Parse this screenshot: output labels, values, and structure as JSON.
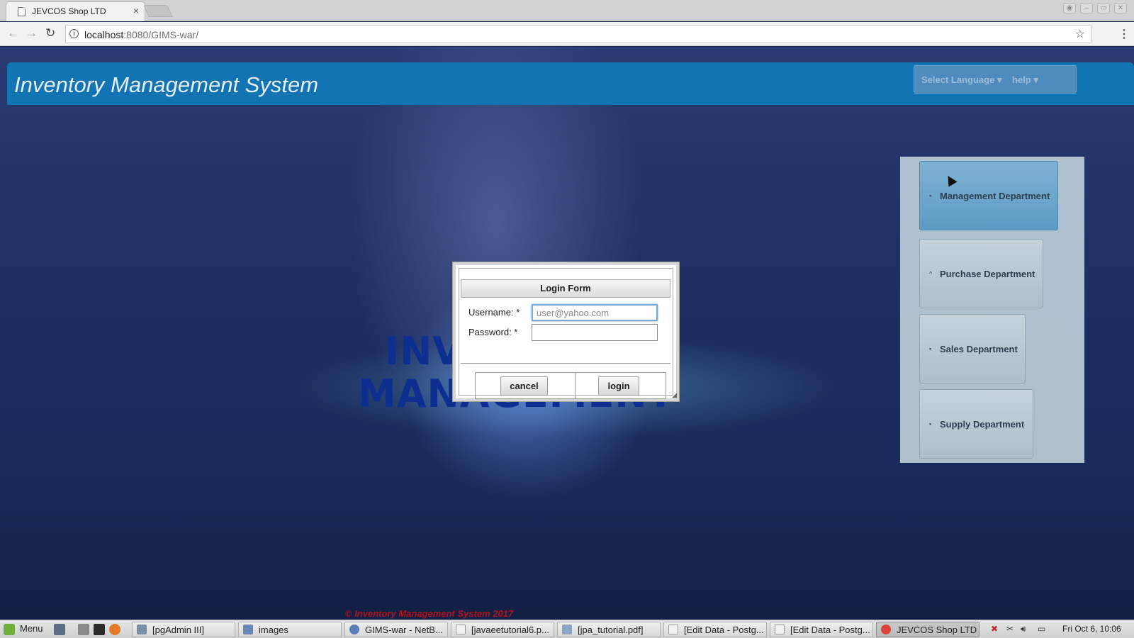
{
  "browser": {
    "tab_title": "JEVCOS Shop LTD",
    "tab_close": "×",
    "url_host": "localhost",
    "url_path": ":8080/GIMS-war/",
    "back_icon": "←",
    "forward_icon": "→",
    "reload_icon": "↻",
    "info_icon": "i",
    "star_icon": "☆",
    "menu_icon": "⋮",
    "window_controls": [
      "◉",
      "–",
      "▭",
      "✕"
    ]
  },
  "header": {
    "app_title": "Inventory Management System",
    "language_label": "Select Language ▾",
    "help_label": "help ▾"
  },
  "background": {
    "line1": "INV",
    "line2": "MANAGEMENT"
  },
  "departments": [
    {
      "label": "Management Department",
      "icon": "▪"
    },
    {
      "label": "Purchase Department",
      "icon": "^"
    },
    {
      "label": "Sales Department",
      "icon": "▪"
    },
    {
      "label": "Supply Department",
      "icon": "▪"
    }
  ],
  "login": {
    "title": "Login Form",
    "username_label": "Username:  *",
    "username_placeholder": "user@yahoo.com",
    "password_label": "Password:  *",
    "cancel_label": "cancel",
    "login_label": "login"
  },
  "footer": {
    "copyright": "© Inventory Management System 2017"
  },
  "taskbar": {
    "menu_label": "Menu",
    "items": [
      {
        "label": "[pgAdmin III]"
      },
      {
        "label": "images"
      },
      {
        "label": "GIMS-war - NetB..."
      },
      {
        "label": "[javaeetutorial6.p..."
      },
      {
        "label": "[jpa_tutorial.pdf]"
      },
      {
        "label": "[Edit Data - Postg..."
      },
      {
        "label": "[Edit Data - Postg..."
      },
      {
        "label": "JEVCOS Shop LTD ..."
      }
    ],
    "clock": "Fri Oct  6, 10:06"
  },
  "colors": {
    "header_blue": "#1374b3",
    "active_department": "#5d9bc5",
    "footer_red": "#b31218"
  }
}
